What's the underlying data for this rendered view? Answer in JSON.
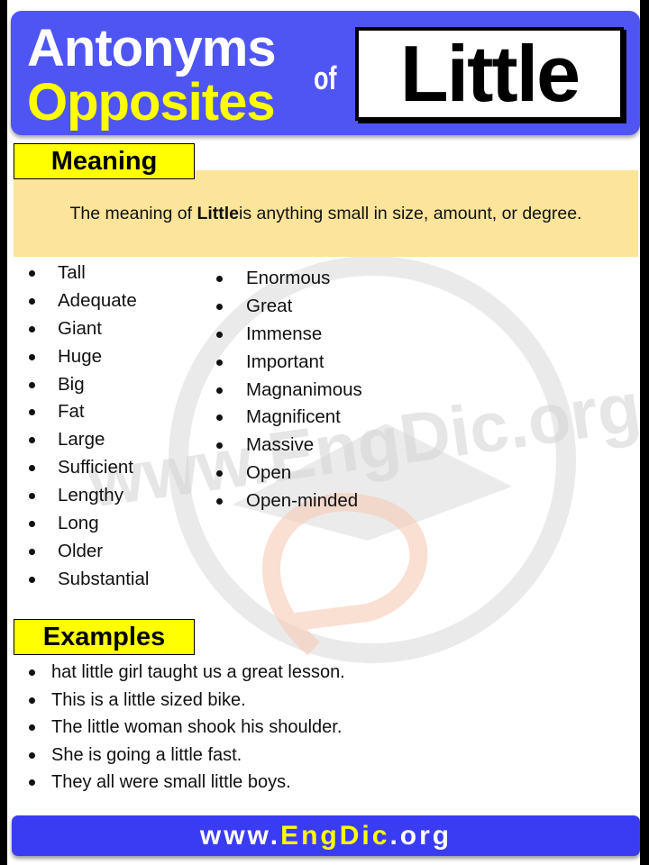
{
  "header": {
    "line1": "Antonyms",
    "line2": "Opposites",
    "connector": "of",
    "word": "Little"
  },
  "meaning": {
    "label": "Meaning",
    "prefix": "The meaning of ",
    "word": "Little",
    "suffix": " is anything small in size,  amount, or degree."
  },
  "antonyms": {
    "column1": [
      "Tall",
      "Adequate",
      "Giant",
      "Huge",
      "Big",
      "Fat",
      "Large",
      "Sufficient",
      "Lengthy",
      "Long",
      "Older",
      "Substantial"
    ],
    "column2": [
      "Enormous",
      "Great",
      "Immense",
      "Important",
      "Magnanimous",
      "Magnificent",
      "Massive",
      "Open",
      "Open-minded"
    ]
  },
  "examples": {
    "label": "Examples",
    "items": [
      "hat little girl taught us a great lesson.",
      "This is a little sized bike.",
      "The little woman shook his shoulder.",
      "She is going a little fast.",
      "They all were small little boys."
    ]
  },
  "footer": {
    "prefix": "www.",
    "brand": "EngDic",
    "suffix": ".org"
  },
  "watermark": {
    "text": "www.EngDic.org"
  },
  "colors": {
    "header_bg": "#4f55f3",
    "footer_bg": "#3a3cf4",
    "highlight_yellow": "#ffff00",
    "meaning_bg": "#fde49b"
  }
}
